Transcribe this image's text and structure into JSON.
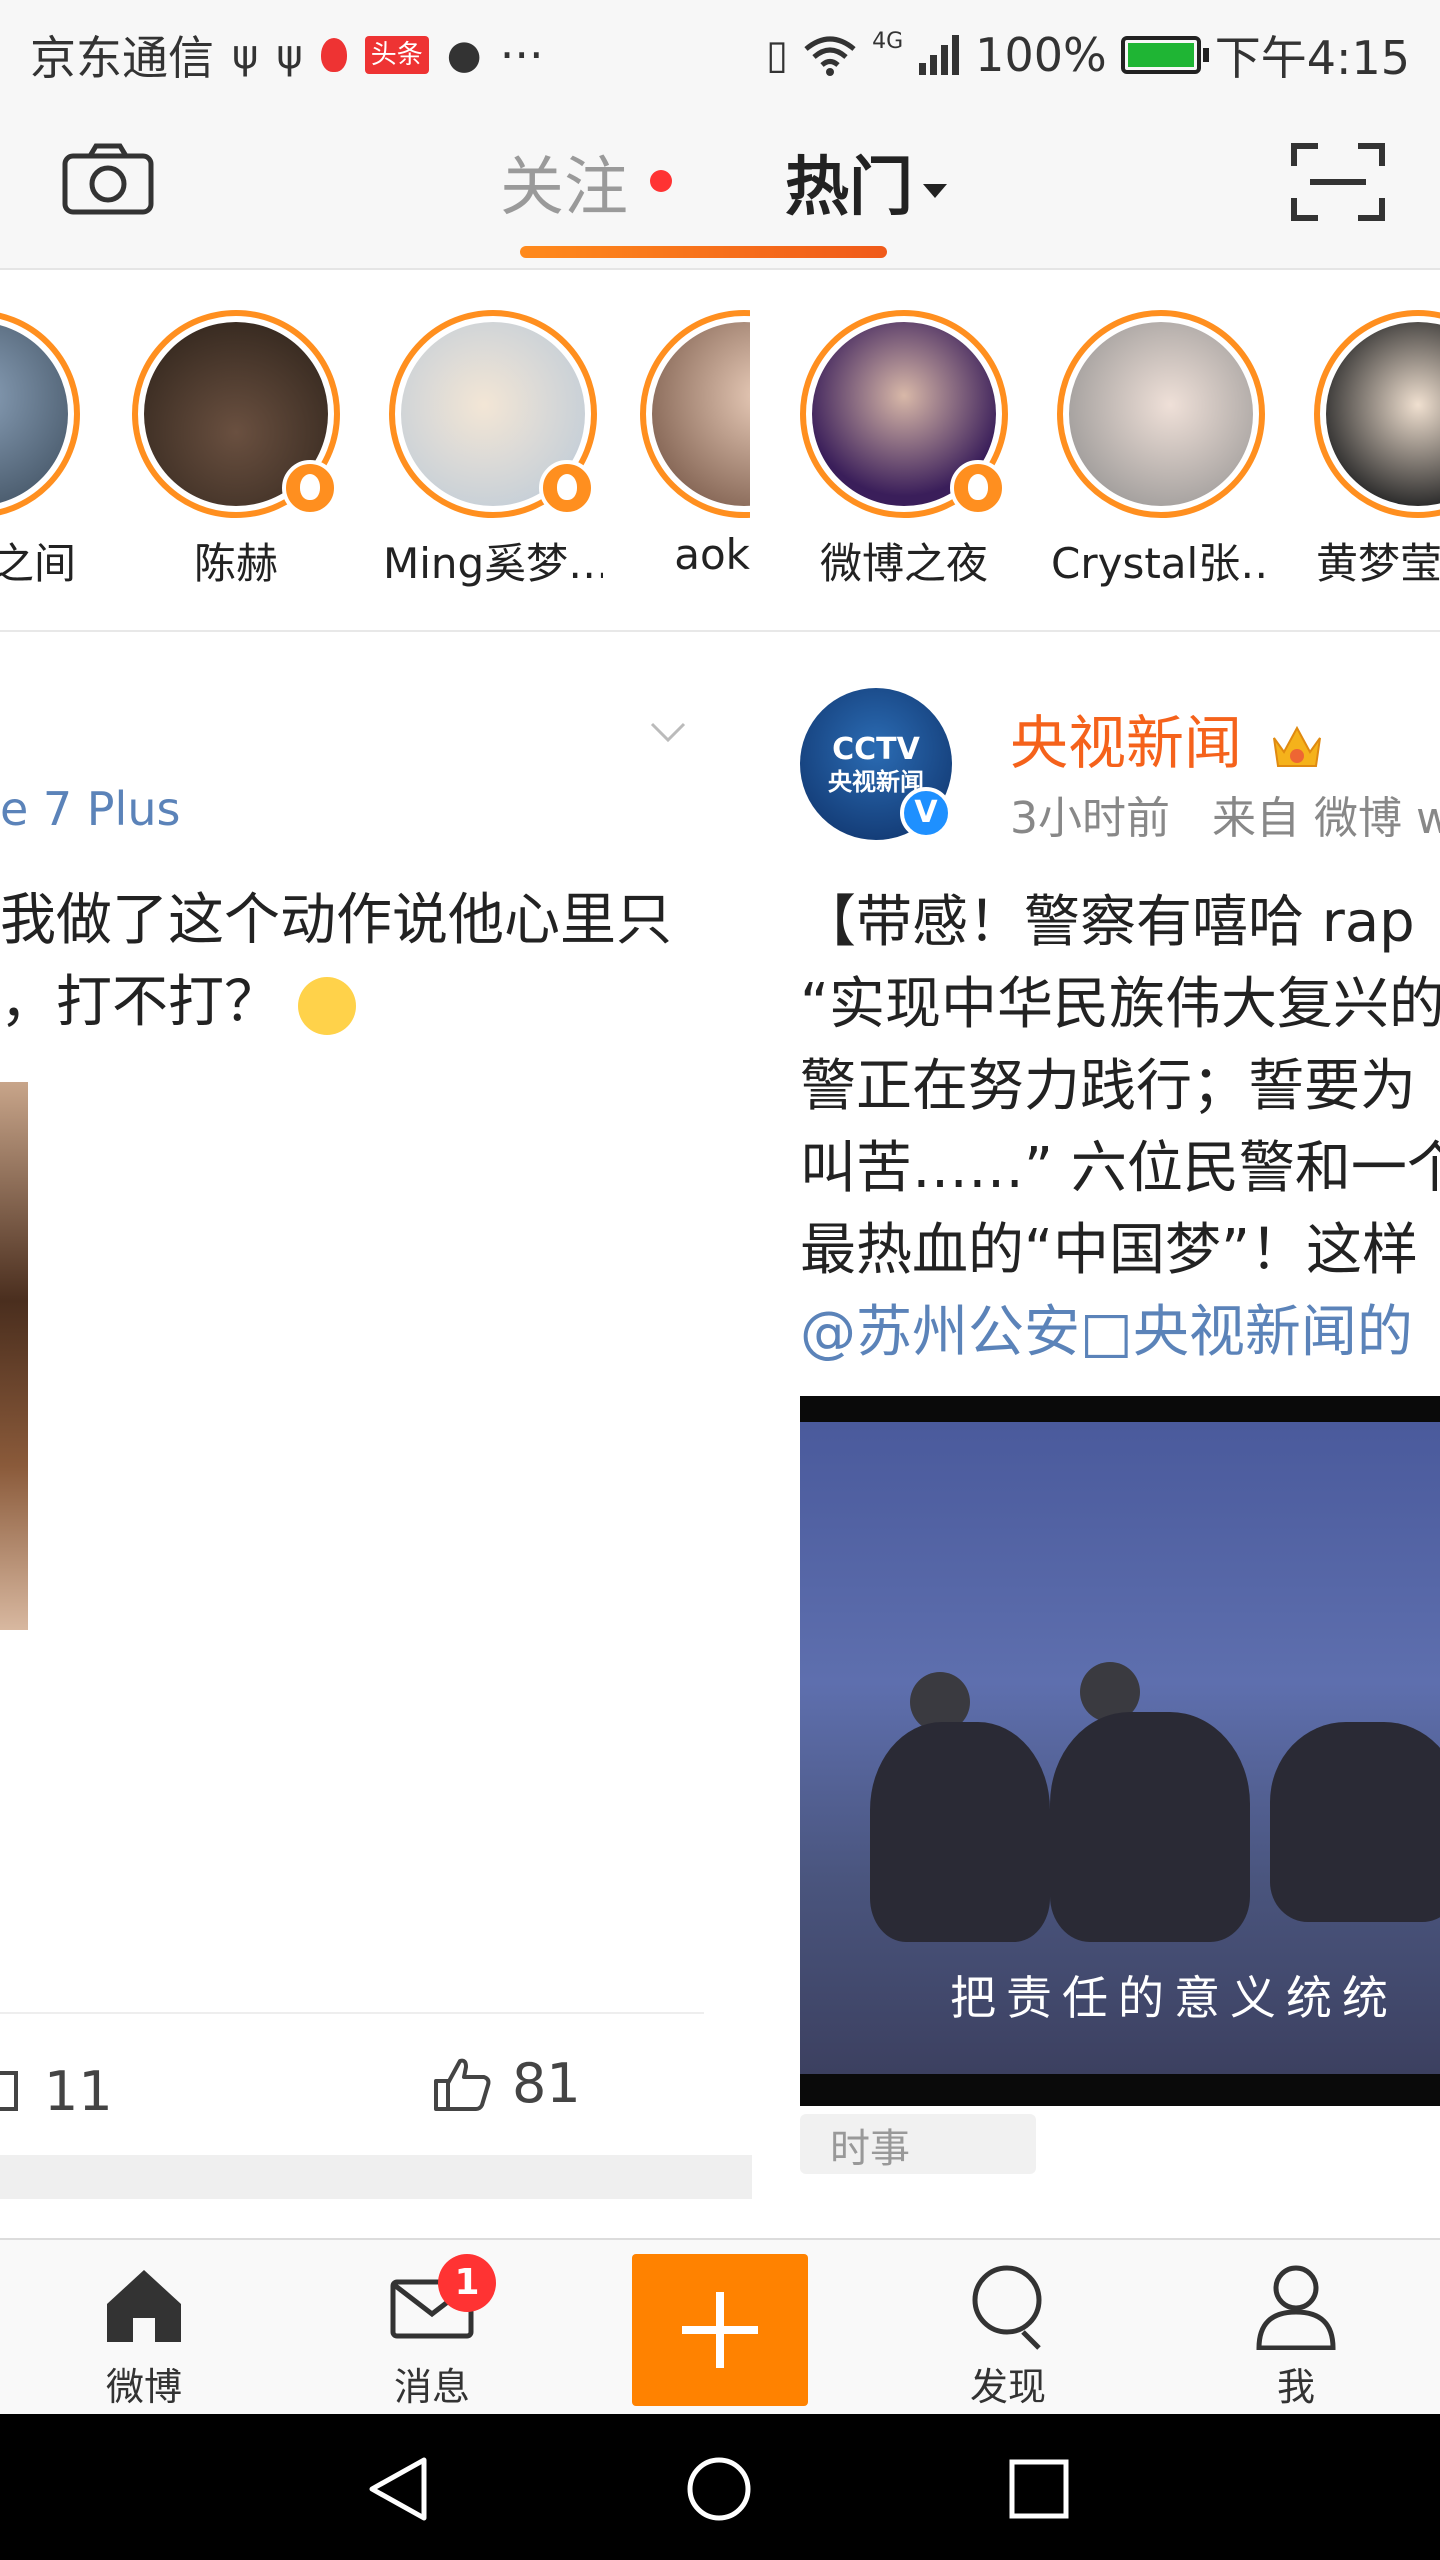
{
  "status_bar": {
    "carrier": "京东通信",
    "news_badge": "头条",
    "more": "···",
    "network": "4G",
    "battery": "100%",
    "battery_level": 1.0,
    "time": "下午4:15"
  },
  "header": {
    "tabs": [
      {
        "label": "关注",
        "has_dot": true
      },
      {
        "label": "热门",
        "active": true
      }
    ]
  },
  "stories": [
    {
      "label": "之间"
    },
    {
      "label": "陈赫"
    },
    {
      "label": "Ming奚梦…"
    },
    {
      "label": "aok"
    },
    {
      "label": "微博之夜"
    },
    {
      "label": "Crystal张…"
    },
    {
      "label": "黄梦莹"
    }
  ],
  "left_card": {
    "device": "e 7 Plus",
    "text_line1": "我做了这个动作说他心里只",
    "text_line2": "，打不打？",
    "comments": "11",
    "likes": "81"
  },
  "right_card": {
    "avatar_logo": "CCTV",
    "avatar_sub": "央视新闻",
    "verified": "V",
    "author": "央视新闻",
    "time": "3小时前",
    "source": "来自 微博 w",
    "lines": [
      "【带感！警察有嘻哈 rap",
      "“实现中华民族伟大复兴的",
      "警正在努力践行；誓要为",
      "叫苦……” 六位民警和一个",
      "最热血的“中国梦”！这样"
    ],
    "link_line": "@苏州公安□央视新闻的",
    "video_subtitle": "把责任的意义统统",
    "tag": "时事"
  },
  "tab_bar": {
    "items": [
      {
        "label": "微博"
      },
      {
        "label": "消息",
        "badge": "1"
      },
      {
        "label": "发现"
      },
      {
        "label": "我"
      }
    ]
  },
  "colors": {
    "accent": "#ff8200",
    "link": "#5b83b9",
    "author": "#f5621b",
    "story_ring": "#ff8f1f"
  }
}
